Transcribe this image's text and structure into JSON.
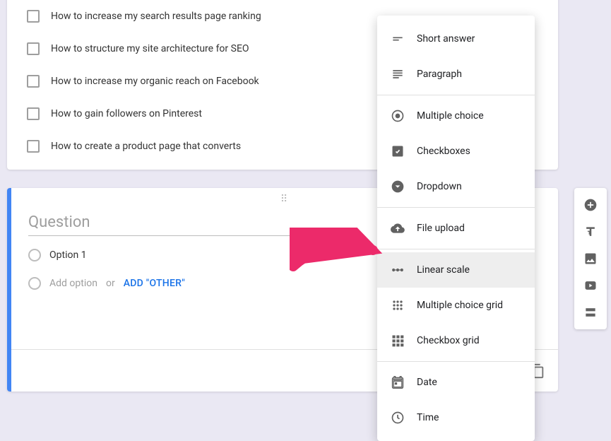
{
  "checkboxes": [
    "How to increase my search results page ranking",
    "How to structure my site architecture for SEO",
    "How to increase my organic reach on Facebook",
    "How to gain followers on Pinterest",
    "How to create a product page that converts"
  ],
  "question": {
    "title_placeholder": "Question",
    "option1": "Option 1",
    "add_option": "Add option",
    "or": "or",
    "add_other": "ADD \"OTHER\""
  },
  "menu": {
    "short_answer": "Short answer",
    "paragraph": "Paragraph",
    "multiple_choice": "Multiple choice",
    "checkboxes": "Checkboxes",
    "dropdown": "Dropdown",
    "file_upload": "File upload",
    "linear_scale": "Linear scale",
    "mc_grid": "Multiple choice grid",
    "cb_grid": "Checkbox grid",
    "date": "Date",
    "time": "Time"
  }
}
